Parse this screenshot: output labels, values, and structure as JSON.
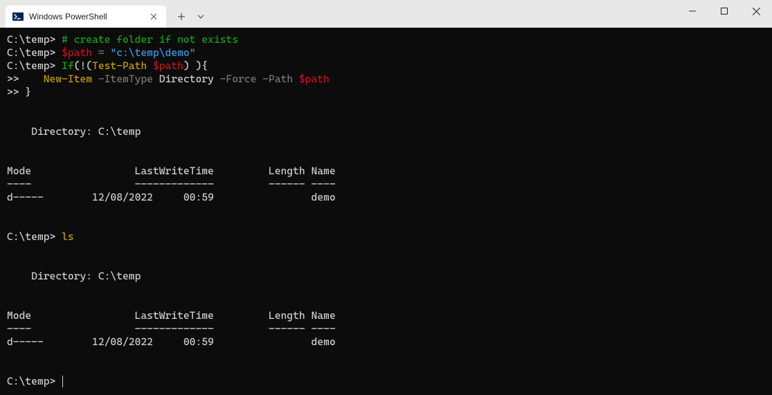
{
  "tab": {
    "title": "Windows PowerShell"
  },
  "prompt": "C:\\temp>",
  "cont": ">>",
  "lines": {
    "l1_comment": "# create folder if not exists",
    "l2_var": "$path",
    "l2_eq": " = ",
    "l2_str": "\"c:\\temp\\demo\"",
    "l3_if": "If",
    "l3_p1": "(!(",
    "l3_cmd": "Test-Path",
    "l3_sp": " ",
    "l3_var": "$path",
    "l3_p2": ") ){",
    "l4_indent": "    ",
    "l4_cmd": "New-Item",
    "l4_p1": " -ItemType",
    "l4_a1": " Directory",
    "l4_p2": " -Force",
    "l4_p3": " -Path",
    "l4_sp": " ",
    "l4_var": "$path",
    "l5": "}",
    "dir_label": "    Directory: C:\\temp",
    "hdr": "Mode                 LastWriteTime         Length Name",
    "sep": "----                 -------------         ------ ----",
    "row": "d-----        12/08/2022     00:59                demo",
    "ls": "ls"
  }
}
